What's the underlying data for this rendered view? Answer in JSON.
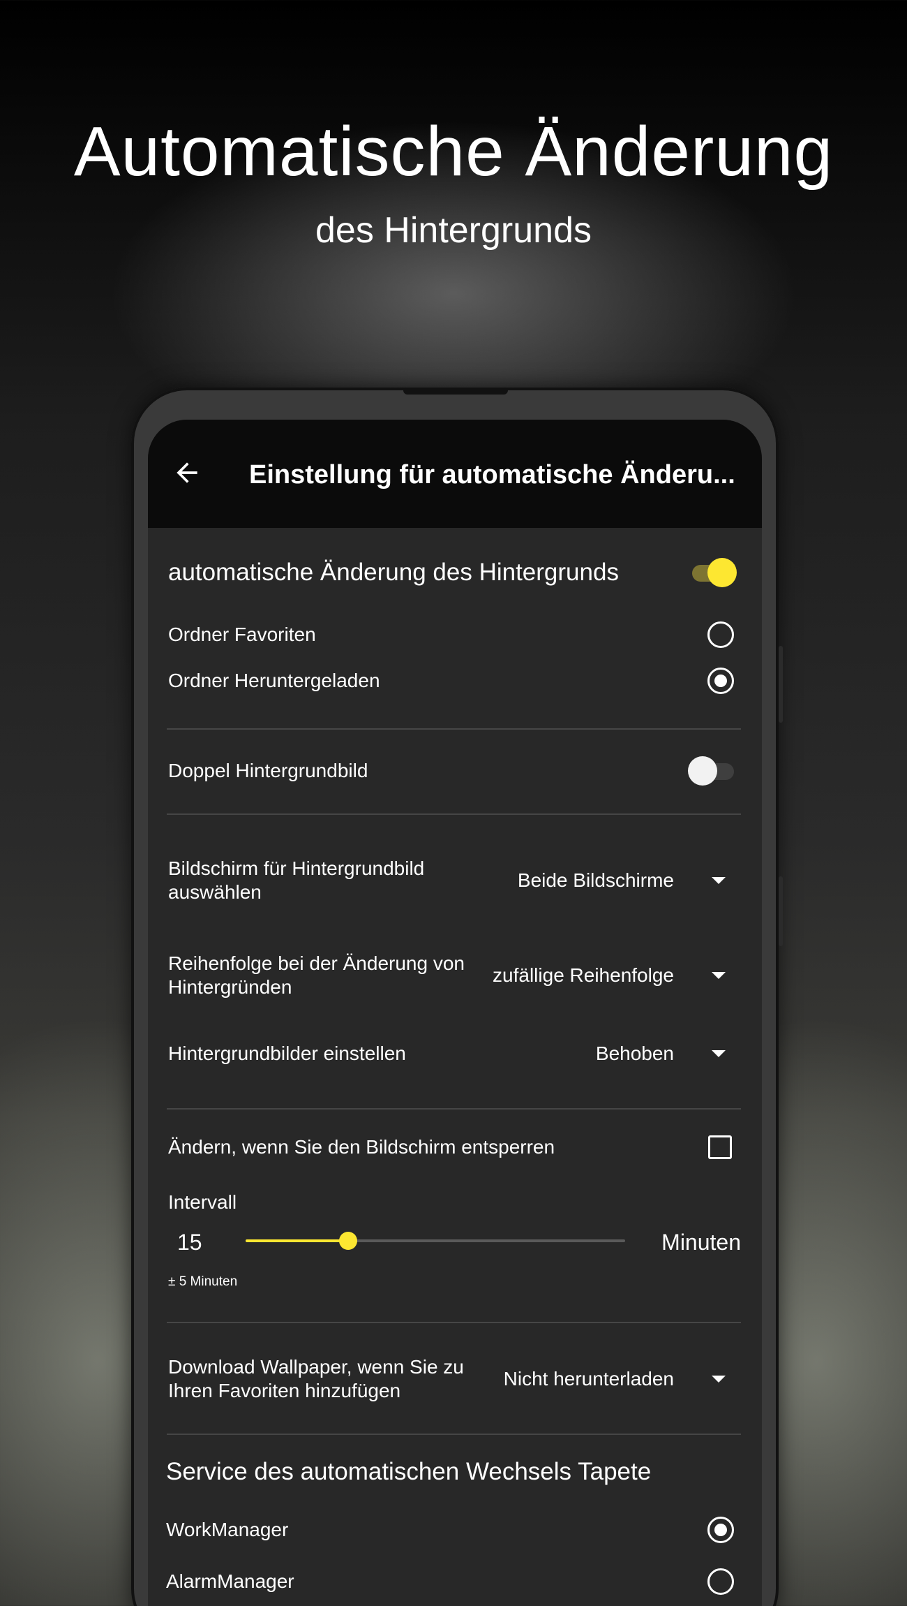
{
  "hero": {
    "title": "Automatische Änderung",
    "subtitle": "des Hintergrunds"
  },
  "appbar": {
    "title": "Einstellung für automatische Änderu..."
  },
  "auto_change": {
    "label": "automatische Änderung des Hintergrunds",
    "enabled": true
  },
  "folders": [
    {
      "label": "Ordner Favoriten",
      "selected": false
    },
    {
      "label": "Ordner Heruntergeladen",
      "selected": true
    }
  ],
  "double_wallpaper": {
    "label": "Doppel Hintergrundbild",
    "enabled": false
  },
  "dropdowns": {
    "screen": {
      "label": "Bildschirm für Hintergrundbild auswählen",
      "value": "Beide Bildschirme"
    },
    "order": {
      "label": "Reihenfolge bei der Änderung von Hintergründen",
      "value": "zufällige Reihenfolge"
    },
    "set_wallpapers": {
      "label": "Hintergrundbilder einstellen",
      "value": "Behoben"
    },
    "download": {
      "label": "Download Wallpaper, wenn Sie zu Ihren Favoriten hinzufügen",
      "value": "Nicht herunterladen"
    }
  },
  "unlock_change": {
    "label": "Ändern, wenn Sie den Bildschirm entsperren",
    "checked": false
  },
  "interval": {
    "label": "Intervall",
    "value": "15",
    "hint": "± 5 Minuten",
    "unit": "Minuten",
    "slider_fraction": 0.27
  },
  "service": {
    "title": "Service des automatischen Wechsels Tapete",
    "options": [
      {
        "label": "WorkManager",
        "selected": true
      },
      {
        "label": "AlarmManager",
        "selected": false
      }
    ]
  },
  "colors": {
    "accent": "#fde731",
    "screen_bg": "#282828",
    "appbar_bg": "#0b0b0b"
  }
}
